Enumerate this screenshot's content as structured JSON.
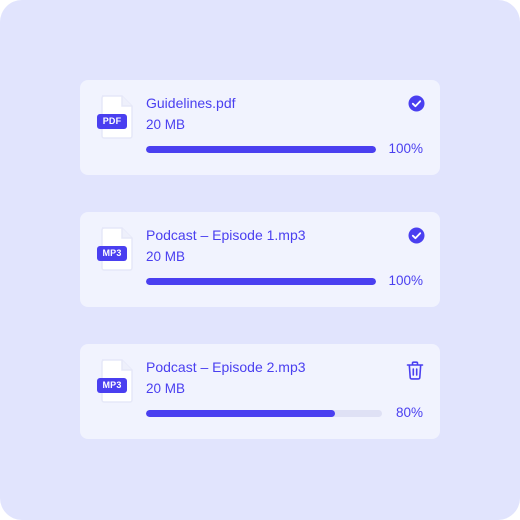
{
  "colors": {
    "accent": "#4a3ff0",
    "panel_background": "#e1e4fd",
    "card_background": "#f1f3fe",
    "progress_track": "#dfe1f5"
  },
  "uploads": [
    {
      "file_type": "PDF",
      "name": "Guidelines.pdf",
      "size": "20 MB",
      "progress_value": 1.0,
      "progress_label": "100%",
      "status_icon": "check-circle-icon"
    },
    {
      "file_type": "MP3",
      "name": "Podcast – Episode 1.mp3",
      "size": "20 MB",
      "progress_value": 1.0,
      "progress_label": "100%",
      "status_icon": "check-circle-icon"
    },
    {
      "file_type": "MP3",
      "name": "Podcast – Episode 2.mp3",
      "size": "20 MB",
      "progress_value": 0.8,
      "progress_label": "80%",
      "status_icon": "trash-icon"
    }
  ]
}
